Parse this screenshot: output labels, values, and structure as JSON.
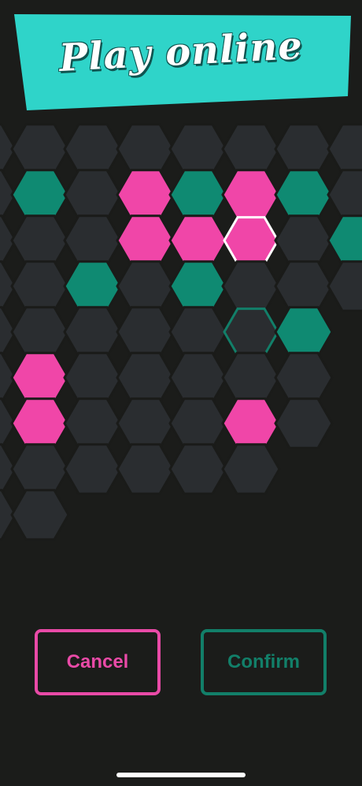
{
  "header": {
    "title": "Play online"
  },
  "buttons": {
    "cancel_label": "Cancel",
    "confirm_label": "Confirm"
  },
  "colors": {
    "background": "#1b1c1a",
    "banner": "#2fd4c9",
    "cell_empty": "#2a2d30",
    "cell_stroke": "#1a1b19",
    "pink": "#f046a8",
    "green": "#0f8a72",
    "selected_outline": "#ffffff",
    "candidate_outline": "#127f69"
  },
  "board": {
    "cells": [
      {
        "col": 0,
        "row": 0,
        "state": "empty"
      },
      {
        "col": 0,
        "row": 1,
        "state": "empty"
      },
      {
        "col": 0,
        "row": 2,
        "state": "empty"
      },
      {
        "col": 0,
        "row": 3,
        "state": "empty"
      },
      {
        "col": 0,
        "row": 4,
        "state": "empty"
      },
      {
        "col": 0,
        "row": 5,
        "state": "empty"
      },
      {
        "col": 0,
        "row": 6,
        "state": "empty"
      },
      {
        "col": 0,
        "row": 7,
        "state": "empty"
      },
      {
        "col": 0,
        "row": 8,
        "state": "empty"
      },
      {
        "col": 1,
        "row": 0,
        "state": "empty"
      },
      {
        "col": 1,
        "row": 1,
        "state": "green"
      },
      {
        "col": 1,
        "row": 2,
        "state": "empty"
      },
      {
        "col": 1,
        "row": 3,
        "state": "empty"
      },
      {
        "col": 1,
        "row": 4,
        "state": "empty"
      },
      {
        "col": 1,
        "row": 5,
        "state": "pink"
      },
      {
        "col": 1,
        "row": 6,
        "state": "pink"
      },
      {
        "col": 1,
        "row": 7,
        "state": "empty"
      },
      {
        "col": 1,
        "row": 8,
        "state": "empty"
      },
      {
        "col": 2,
        "row": 0,
        "state": "empty"
      },
      {
        "col": 2,
        "row": 1,
        "state": "empty"
      },
      {
        "col": 2,
        "row": 2,
        "state": "empty"
      },
      {
        "col": 2,
        "row": 3,
        "state": "green"
      },
      {
        "col": 2,
        "row": 4,
        "state": "empty"
      },
      {
        "col": 2,
        "row": 5,
        "state": "empty"
      },
      {
        "col": 2,
        "row": 6,
        "state": "empty"
      },
      {
        "col": 2,
        "row": 7,
        "state": "empty"
      },
      {
        "col": 3,
        "row": 0,
        "state": "empty"
      },
      {
        "col": 3,
        "row": 1,
        "state": "pink"
      },
      {
        "col": 3,
        "row": 2,
        "state": "pink"
      },
      {
        "col": 3,
        "row": 3,
        "state": "empty"
      },
      {
        "col": 3,
        "row": 4,
        "state": "empty"
      },
      {
        "col": 3,
        "row": 5,
        "state": "empty"
      },
      {
        "col": 3,
        "row": 6,
        "state": "empty"
      },
      {
        "col": 3,
        "row": 7,
        "state": "empty"
      },
      {
        "col": 4,
        "row": 0,
        "state": "empty"
      },
      {
        "col": 4,
        "row": 1,
        "state": "green"
      },
      {
        "col": 4,
        "row": 2,
        "state": "pink"
      },
      {
        "col": 4,
        "row": 3,
        "state": "green"
      },
      {
        "col": 4,
        "row": 4,
        "state": "empty"
      },
      {
        "col": 4,
        "row": 5,
        "state": "empty"
      },
      {
        "col": 4,
        "row": 6,
        "state": "empty"
      },
      {
        "col": 4,
        "row": 7,
        "state": "empty"
      },
      {
        "col": 5,
        "row": 0,
        "state": "empty"
      },
      {
        "col": 5,
        "row": 1,
        "state": "pink"
      },
      {
        "col": 5,
        "row": 2,
        "state": "pink",
        "selected": true
      },
      {
        "col": 5,
        "row": 3,
        "state": "empty"
      },
      {
        "col": 5,
        "row": 4,
        "state": "candidate"
      },
      {
        "col": 5,
        "row": 5,
        "state": "empty"
      },
      {
        "col": 5,
        "row": 6,
        "state": "pink"
      },
      {
        "col": 5,
        "row": 7,
        "state": "empty"
      },
      {
        "col": 6,
        "row": 0,
        "state": "empty"
      },
      {
        "col": 6,
        "row": 1,
        "state": "green"
      },
      {
        "col": 6,
        "row": 2,
        "state": "empty"
      },
      {
        "col": 6,
        "row": 3,
        "state": "empty"
      },
      {
        "col": 6,
        "row": 4,
        "state": "green"
      },
      {
        "col": 6,
        "row": 5,
        "state": "empty"
      },
      {
        "col": 6,
        "row": 6,
        "state": "empty"
      },
      {
        "col": 7,
        "row": 0,
        "state": "empty"
      },
      {
        "col": 7,
        "row": 1,
        "state": "empty"
      },
      {
        "col": 7,
        "row": 2,
        "state": "green"
      },
      {
        "col": 7,
        "row": 3,
        "state": "empty"
      },
      {
        "col": 8,
        "row": 0,
        "state": "empty"
      },
      {
        "col": 8,
        "row": 1,
        "state": "empty"
      },
      {
        "col": 8,
        "row": 2,
        "state": "green"
      }
    ]
  }
}
